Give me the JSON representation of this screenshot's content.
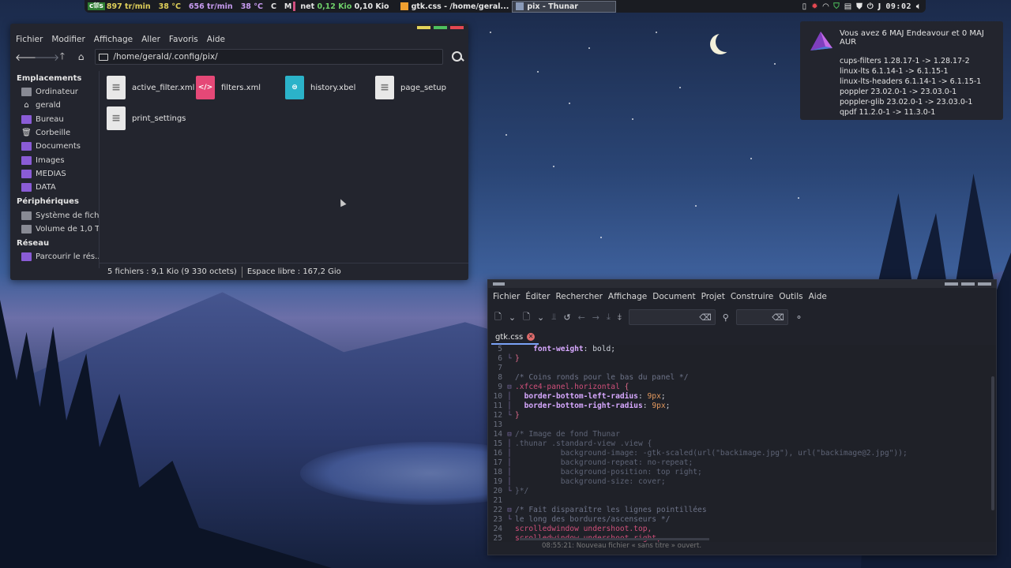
{
  "colors": {
    "accent": "#8a5cd6",
    "close": "#e54851",
    "maximize": "#4ec25e",
    "minimize": "#e2d35a"
  },
  "topbar": {
    "cpu_badge": "c⛆s",
    "cpu_fan": "897 tr/min",
    "cpu_temp": "38 °C",
    "gpu_fan": "656 tr/min",
    "gpu_temp": "38 °C",
    "c_label": "C",
    "m_label": "M",
    "net_label": "net",
    "net_down": "0,12 Kio",
    "net_up": "0,10 Kio",
    "tasks": [
      {
        "label": "gtk.css - /home/geral...",
        "icon": "text-editor-icon"
      },
      {
        "label": "pix - Thunar",
        "icon": "folder-icon"
      }
    ],
    "clock": "09:02"
  },
  "thunar": {
    "menu": [
      "Fichier",
      "Modifier",
      "Affichage",
      "Aller",
      "Favoris",
      "Aide"
    ],
    "path": "/home/gerald/.config/pix/",
    "sidebar": {
      "places_header": "Emplacements",
      "places": [
        "Ordinateur",
        "gerald",
        "Bureau",
        "Corbeille",
        "Documents",
        "Images",
        "MEDIAS",
        "DATA"
      ],
      "devices_header": "Périphériques",
      "devices": [
        "Système de fich...",
        "Volume de 1,0 To"
      ],
      "network_header": "Réseau",
      "network": [
        "Parcourir le rés..."
      ]
    },
    "files": [
      {
        "name": "active_filter.xml",
        "type": "doc"
      },
      {
        "name": "filters.xml",
        "type": "xml"
      },
      {
        "name": "history.xbel",
        "type": "xbel"
      },
      {
        "name": "page_setup",
        "type": "doc"
      },
      {
        "name": "print_settings",
        "type": "doc"
      }
    ],
    "status_left": "5 fichiers : 9,1 Kio (9 330 octets)",
    "status_right": "Espace libre : 167,2 Gio"
  },
  "notification": {
    "title": "Vous avez 6 MAJ Endeavour et 0 MAJ AUR",
    "lines": [
      "cups-filters 1.28.17-1 -> 1.28.17-2",
      "linux-lts 6.1.14-1 -> 6.1.15-1",
      "linux-lts-headers 6.1.14-1 -> 6.1.15-1",
      "poppler 23.02.0-1 -> 23.03.0-1",
      "poppler-glib 23.02.0-1 -> 23.03.0-1",
      "qpdf 11.2.0-1 -> 11.3.0-1"
    ]
  },
  "geany": {
    "menu": [
      "Fichier",
      "Éditer",
      "Rechercher",
      "Affichage",
      "Document",
      "Projet",
      "Construire",
      "Outils",
      "Aide"
    ],
    "tab": "gtk.css",
    "message": "08:55:21: Nouveau fichier « sans titre » ouvert."
  }
}
